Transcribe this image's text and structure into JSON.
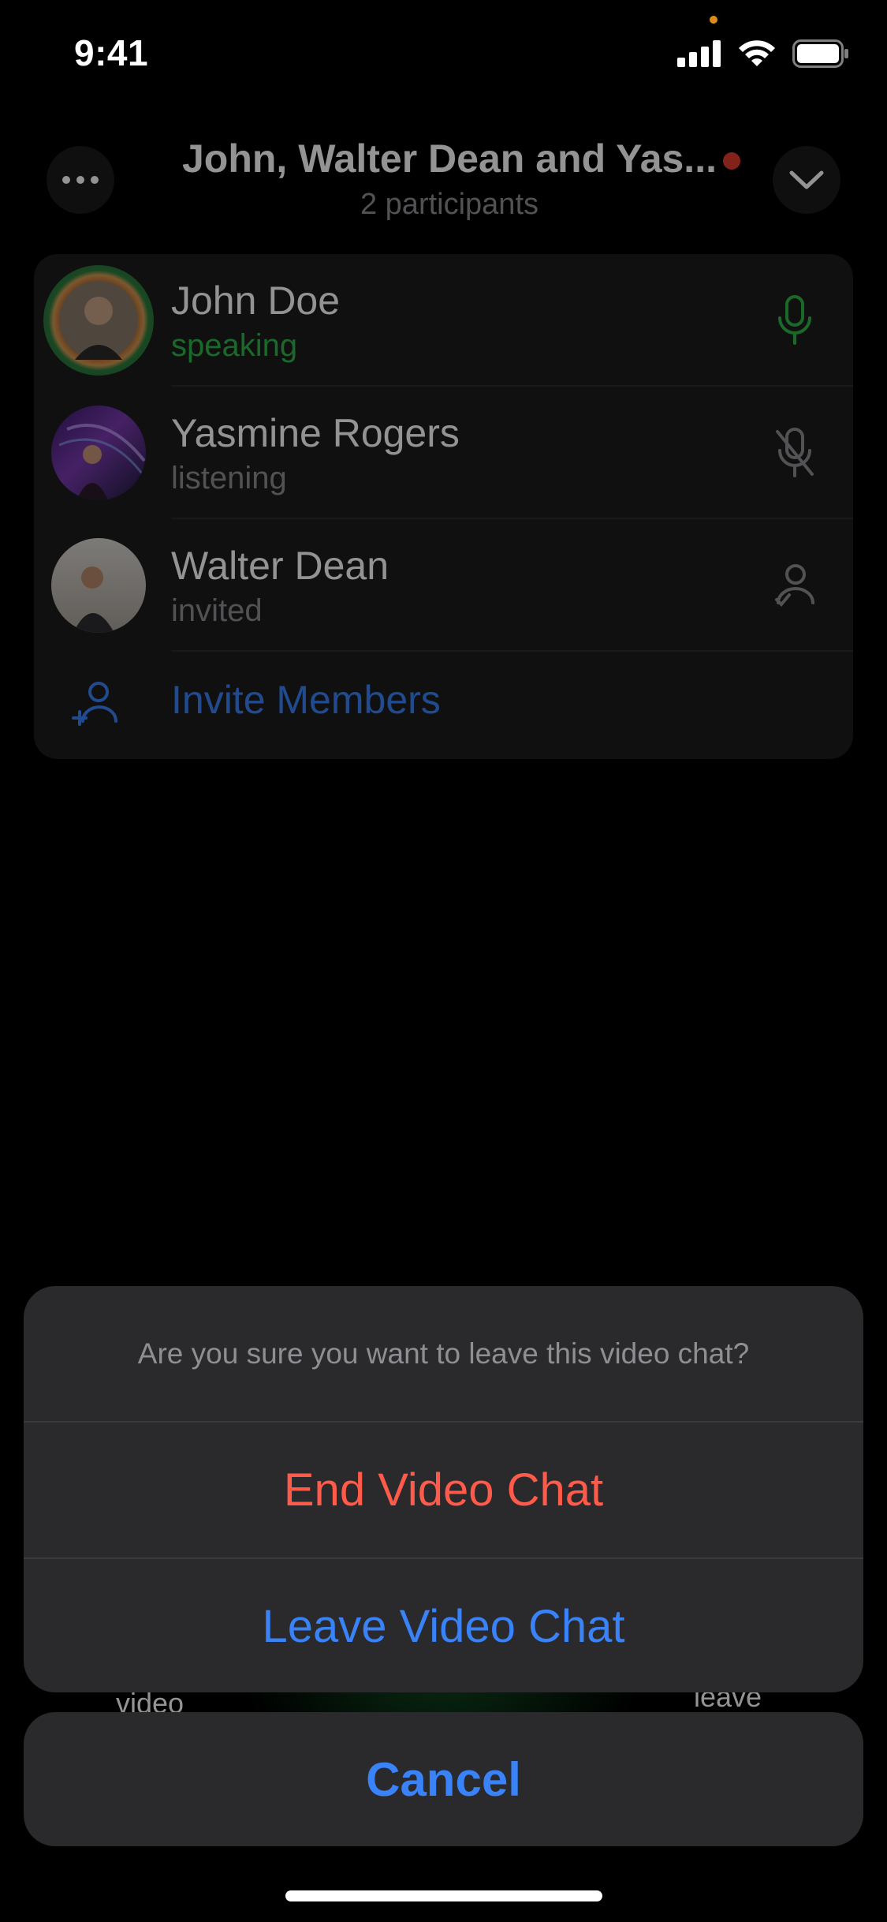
{
  "status_bar": {
    "time": "9:41"
  },
  "header": {
    "title": "John, Walter Dean and Yas...",
    "subtitle": "2 participants"
  },
  "participants": [
    {
      "name": "John Doe",
      "status": "speaking",
      "status_color": "#30b74a",
      "icon": "microphone-icon"
    },
    {
      "name": "Yasmine Rogers",
      "status": "listening",
      "status_color": "#8e8e93",
      "icon": "microphone-muted-icon"
    },
    {
      "name": "Walter Dean",
      "status": "invited",
      "status_color": "#8e8e93",
      "icon": "invited-person-icon"
    }
  ],
  "invite": {
    "label": "Invite Members"
  },
  "background_controls": {
    "left_caption": "video",
    "right_caption": "leave"
  },
  "action_sheet": {
    "message": "Are you sure you want to leave this video chat?",
    "end_label": "End Video Chat",
    "end_color": "#ff5a4a",
    "leave_label": "Leave Video Chat",
    "leave_color": "#3a82f7",
    "cancel_label": "Cancel"
  }
}
